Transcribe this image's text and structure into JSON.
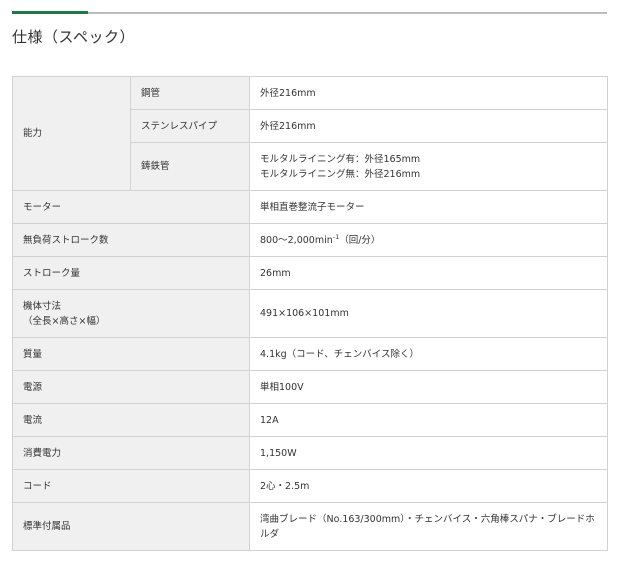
{
  "page": {
    "title": "仕様（スペック）"
  },
  "spec": {
    "capability": {
      "label": "能力",
      "rows": [
        {
          "label": "鋼管",
          "value": "外径216mm"
        },
        {
          "label": "ステンレスパイプ",
          "value": "外径216mm"
        },
        {
          "label": "鋳鉄管",
          "value_line1": "モルタルライニング有：外径165mm",
          "value_line2": "モルタルライニング無：外径216mm"
        }
      ]
    },
    "motor": {
      "label": "モーター",
      "value": "単相直巻整流子モーター"
    },
    "stroke_rate": {
      "label": "無負荷ストローク数",
      "value": "800～2,000min",
      "value_sup": "-1",
      "value_suffix": "（回/分）"
    },
    "stroke_length": {
      "label": "ストローク量",
      "value": "26mm"
    },
    "dimensions": {
      "label_line1": "機体寸法",
      "label_line2": "（全長×高さ×幅）",
      "value": "491×106×101mm"
    },
    "weight": {
      "label": "質量",
      "value": "4.1kg（コード、チェンバイス除く）"
    },
    "power_source": {
      "label": "電源",
      "value": "単相100V"
    },
    "current": {
      "label": "電流",
      "value": "12A"
    },
    "power_consumption": {
      "label": "消費電力",
      "value": "1,150W"
    },
    "cord": {
      "label": "コード",
      "value": "2心・2.5m"
    },
    "accessories": {
      "label": "標準付属品",
      "value": "湾曲ブレード（No.163/300mm）・チェンバイス・六角棒スパナ・ブレードホルダ"
    }
  }
}
